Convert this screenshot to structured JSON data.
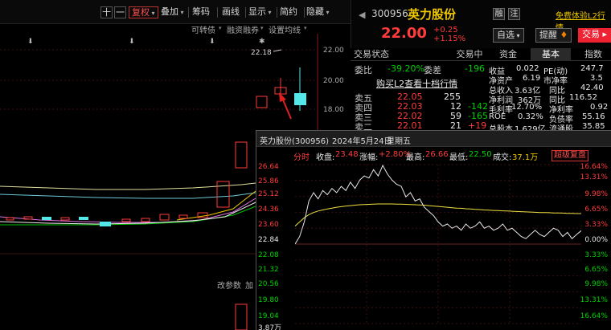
{
  "toolbar": {
    "plus": "十",
    "minus": "一",
    "fuquan": "复权",
    "diejia": "叠加",
    "chouma": "筹码",
    "huaxian": "画线",
    "xianshi": "显示",
    "jianyue": "简约",
    "yincang": "隐藏"
  },
  "chart_options": {
    "kezhuanzhai": "可转债",
    "rongzi": "融资融券",
    "shezhi": "设置均线"
  },
  "left_chart": {
    "price_ticks": [
      "22.00",
      "20.00",
      "18.00"
    ],
    "high_label": "22.18",
    "bottom_labels": {
      "gaicanshu": "改参数",
      "jia": "加"
    }
  },
  "quote": {
    "code": "300956",
    "name": "英力股份",
    "rong": "融",
    "zhu": "注",
    "promo": "免费体验L2行情",
    "price": "22.00",
    "change": "+0.25",
    "change_pct": "+1.15%",
    "zixuan": "自选",
    "tixing": "提醒",
    "jiaoyi": "交易"
  },
  "tabs": {
    "jiaoyi_zhuangtai": "交易状态",
    "jiaoyi_zhong": "交易中",
    "zijin": "资金",
    "jiben": "基本",
    "zhishu": "指数"
  },
  "trade": {
    "weibi_label": "委比",
    "weibi_value": "-39.20%",
    "weicha_label": "委差",
    "weicha_value": "-196",
    "buy_l2": "购买L2查看十档行情",
    "asks": [
      {
        "label": "卖五",
        "price": "22.05",
        "vol": "255",
        "diff": ""
      },
      {
        "label": "卖四",
        "price": "22.03",
        "vol": "12",
        "diff": "-142"
      },
      {
        "label": "卖三",
        "price": "22.02",
        "vol": "59",
        "diff": "-165"
      },
      {
        "label": "卖二",
        "price": "22.01",
        "vol": "21",
        "diff": "+19"
      }
    ]
  },
  "fundamentals": [
    {
      "label": "收益",
      "val": "0.022",
      "label2": "PE(动)",
      "val2": "247.7"
    },
    {
      "label": "净资产",
      "val": "6.19",
      "label2": "市净率",
      "val2": "3.5"
    },
    {
      "label": "总收入",
      "val": "3.63亿",
      "label2": "同比",
      "val2": "42.40"
    },
    {
      "label": "净利润",
      "val": "362万",
      "label2": "同比",
      "val2": "116.52"
    },
    {
      "label": "毛利率",
      "val": "12.70%",
      "label2": "净利率",
      "val2": "0.92"
    },
    {
      "label": "ROE",
      "val": "0.32%",
      "label2": "负债率",
      "val2": "55.16"
    },
    {
      "label": "总股本",
      "val": "1.629亿",
      "label2": "流通股",
      "val2": "35.85"
    }
  ],
  "popup": {
    "title_name": "英力股份(300956)",
    "title_date": "2024年5月24日",
    "title_weekday": "星期五",
    "fenshi": "分时",
    "shoupan_label": "收盘:",
    "shoupan": "23.48",
    "zhangfu_label": "涨幅:",
    "zhangfu": "+2.80%",
    "zuigao_label": "最高:",
    "zuigao": "26.66",
    "zuidi_label": "最低:",
    "zuidi": "22.50",
    "chengjiao_label": "成交:",
    "chengjiao": "37.1万",
    "chaoji": "超级复盘",
    "left_axis": [
      "26.64",
      "25.86",
      "25.12",
      "24.36",
      "23.60",
      "22.84",
      "22.08",
      "21.32",
      "20.56",
      "19.80",
      "19.04"
    ],
    "right_axis": [
      "16.64%",
      "13.31%",
      "9.98%",
      "6.65%",
      "3.33%",
      "0.00%",
      "3.33%",
      "6.65%",
      "9.98%",
      "13.31%",
      "16.64%"
    ],
    "volume_label": "3.87万"
  },
  "chart_data": {
    "type": "line",
    "series": [
      {
        "values": [
          22.84,
          23.2,
          23.9,
          24.9,
          25.3,
          25.0,
          25.4,
          25.2,
          25.5,
          25.3,
          25.6,
          25.4,
          25.8,
          25.5,
          25.9,
          26.1,
          26.0,
          26.4,
          26.1,
          26.6,
          26.2,
          25.9,
          25.7,
          25.6,
          25.1,
          25.3,
          24.9,
          25.0,
          24.6,
          24.4,
          24.2,
          23.9,
          23.7,
          23.8,
          23.6,
          23.7,
          23.5,
          23.8,
          23.6,
          23.7,
          23.9,
          23.6,
          23.7,
          23.5,
          23.6,
          23.8,
          23.5,
          23.6,
          23.4,
          23.2,
          23.1,
          23.3,
          23.5,
          23.3,
          23.2,
          23.4,
          23.6,
          23.5,
          23.2,
          23.4,
          23.1,
          23.3,
          23.48
        ]
      },
      {
        "values": [
          23.7,
          23.9,
          24.1,
          24.25,
          24.35,
          24.42,
          24.47,
          24.52,
          24.56,
          24.6,
          24.63,
          24.66,
          24.68,
          24.7,
          24.72,
          24.73,
          24.74,
          24.75,
          24.76,
          24.76,
          24.76,
          24.76,
          24.75,
          24.75,
          24.74,
          24.73,
          24.72,
          24.71,
          24.7,
          24.68,
          24.66,
          24.64,
          24.62,
          24.6,
          24.58,
          24.56,
          24.55,
          24.53,
          24.52,
          24.5,
          24.49,
          24.47,
          24.46,
          24.45,
          24.44,
          24.43,
          24.42,
          24.41,
          24.4,
          24.39,
          24.38,
          24.37,
          24.36,
          24.35,
          24.35,
          24.34,
          24.33,
          24.33,
          24.32,
          24.31,
          24.31,
          24.3,
          24.3
        ]
      }
    ],
    "ylim": [
      19.04,
      26.64
    ],
    "base_price": 22.84,
    "grid": true
  }
}
